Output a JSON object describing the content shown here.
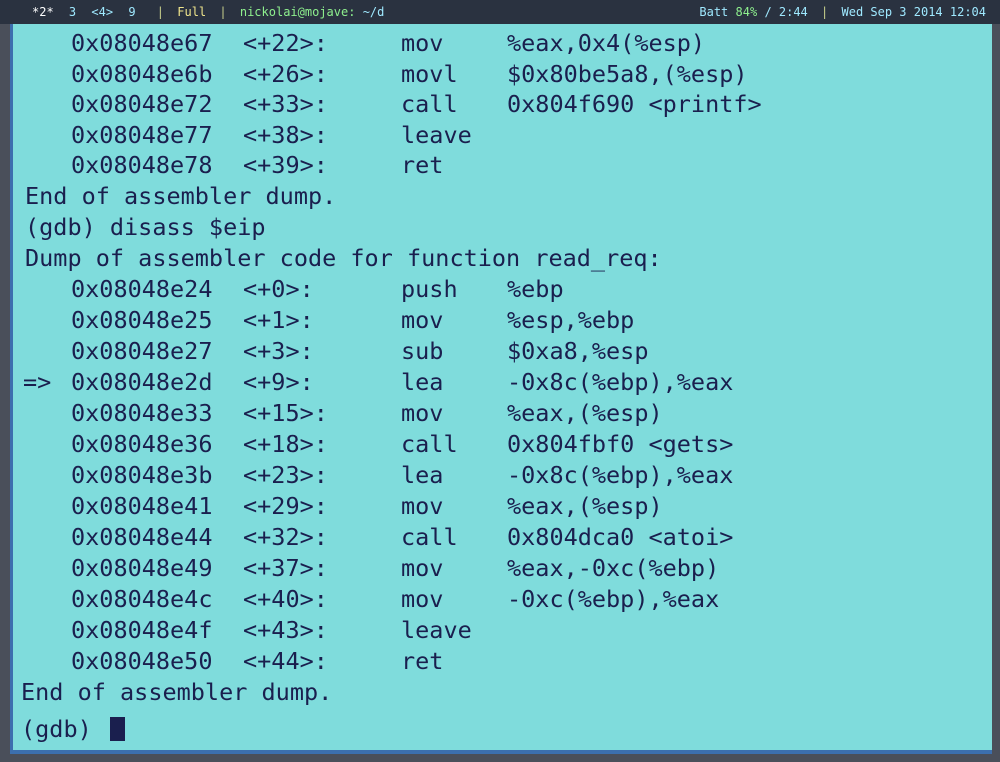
{
  "statusbar": {
    "workspaces": [
      "*2*",
      "3",
      "<4>",
      "9"
    ],
    "layout": "Full",
    "user_host": "nickolai@mojave:",
    "cwd": "~/d",
    "battery_label": "Batt",
    "battery_pct": "84%",
    "battery_time": "/ 2:44",
    "datetime": "Wed Sep  3 2014 12:04"
  },
  "terminal": {
    "block1": [
      {
        "arrow": "",
        "addr": "0x08048e67",
        "off": "<+22>:",
        "mn": "mov",
        "ops": "%eax,0x4(%esp)"
      },
      {
        "arrow": "",
        "addr": "0x08048e6b",
        "off": "<+26>:",
        "mn": "movl",
        "ops": "$0x80be5a8,(%esp)"
      },
      {
        "arrow": "",
        "addr": "0x08048e72",
        "off": "<+33>:",
        "mn": "call",
        "ops": "0x804f690 <printf>"
      },
      {
        "arrow": "",
        "addr": "0x08048e77",
        "off": "<+38>:",
        "mn": "leave",
        "ops": ""
      },
      {
        "arrow": "",
        "addr": "0x08048e78",
        "off": "<+39>:",
        "mn": "ret",
        "ops": ""
      }
    ],
    "end_msg_1": "End of assembler dump.",
    "command": "(gdb) disass $eip",
    "dump_header": "Dump of assembler code for function read_req:",
    "block2": [
      {
        "arrow": "",
        "addr": "0x08048e24",
        "off": "<+0>:",
        "mn": "push",
        "ops": "%ebp"
      },
      {
        "arrow": "",
        "addr": "0x08048e25",
        "off": "<+1>:",
        "mn": "mov",
        "ops": "%esp,%ebp"
      },
      {
        "arrow": "",
        "addr": "0x08048e27",
        "off": "<+3>:",
        "mn": "sub",
        "ops": "$0xa8,%esp"
      },
      {
        "arrow": "=>",
        "addr": "0x08048e2d",
        "off": "<+9>:",
        "mn": "lea",
        "ops": "-0x8c(%ebp),%eax"
      },
      {
        "arrow": "",
        "addr": "0x08048e33",
        "off": "<+15>:",
        "mn": "mov",
        "ops": "%eax,(%esp)"
      },
      {
        "arrow": "",
        "addr": "0x08048e36",
        "off": "<+18>:",
        "mn": "call",
        "ops": "0x804fbf0 <gets>"
      },
      {
        "arrow": "",
        "addr": "0x08048e3b",
        "off": "<+23>:",
        "mn": "lea",
        "ops": "-0x8c(%ebp),%eax"
      },
      {
        "arrow": "",
        "addr": "0x08048e41",
        "off": "<+29>:",
        "mn": "mov",
        "ops": "%eax,(%esp)"
      },
      {
        "arrow": "",
        "addr": "0x08048e44",
        "off": "<+32>:",
        "mn": "call",
        "ops": "0x804dca0 <atoi>"
      },
      {
        "arrow": "",
        "addr": "0x08048e49",
        "off": "<+37>:",
        "mn": "mov",
        "ops": "%eax,-0xc(%ebp)"
      },
      {
        "arrow": "",
        "addr": "0x08048e4c",
        "off": "<+40>:",
        "mn": "mov",
        "ops": "-0xc(%ebp),%eax"
      },
      {
        "arrow": "",
        "addr": "0x08048e4f",
        "off": "<+43>:",
        "mn": "leave",
        "ops": ""
      },
      {
        "arrow": "",
        "addr": "0x08048e50",
        "off": "<+44>:",
        "mn": "ret",
        "ops": ""
      }
    ],
    "end_msg_2": "End of assembler dump.",
    "prompt": "(gdb) "
  }
}
